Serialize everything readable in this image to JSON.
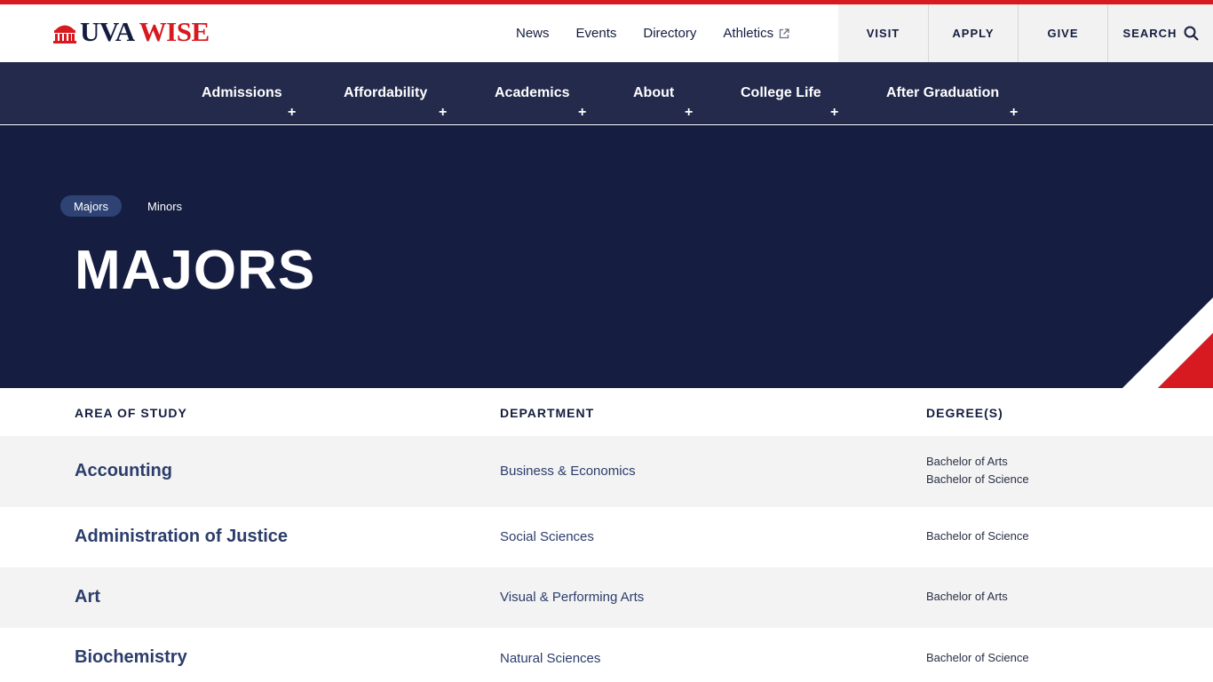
{
  "brand": {
    "logo_uva": "UVA",
    "logo_wise": "WISE",
    "accent": "#d71920",
    "navy": "#151d40"
  },
  "utility_nav": {
    "links": [
      "News",
      "Events",
      "Directory",
      "Athletics"
    ],
    "external_icon": "external-link-icon",
    "cta": {
      "visit": "VISIT",
      "apply": "APPLY",
      "give": "GIVE",
      "search": "SEARCH"
    }
  },
  "main_nav": {
    "items": [
      "Admissions",
      "Affordability",
      "Academics",
      "About",
      "College Life",
      "After Graduation"
    ],
    "expand_symbol": "+"
  },
  "hero": {
    "tabs": [
      "Majors",
      "Minors"
    ],
    "active_tab": "Majors",
    "title": "MAJORS"
  },
  "table": {
    "headers": {
      "area": "AREA OF STUDY",
      "department": "DEPARTMENT",
      "degrees": "DEGREE(S)"
    },
    "rows": [
      {
        "area": "Accounting",
        "department": "Business & Economics",
        "degrees": [
          "Bachelor of Arts",
          "Bachelor of Science"
        ]
      },
      {
        "area": "Administration of Justice",
        "department": "Social Sciences",
        "degrees": [
          "Bachelor of Science"
        ]
      },
      {
        "area": "Art",
        "department": "Visual & Performing Arts",
        "degrees": [
          "Bachelor of Arts"
        ]
      },
      {
        "area": "Biochemistry",
        "department": "Natural Sciences",
        "degrees": [
          "Bachelor of Science"
        ]
      }
    ]
  }
}
